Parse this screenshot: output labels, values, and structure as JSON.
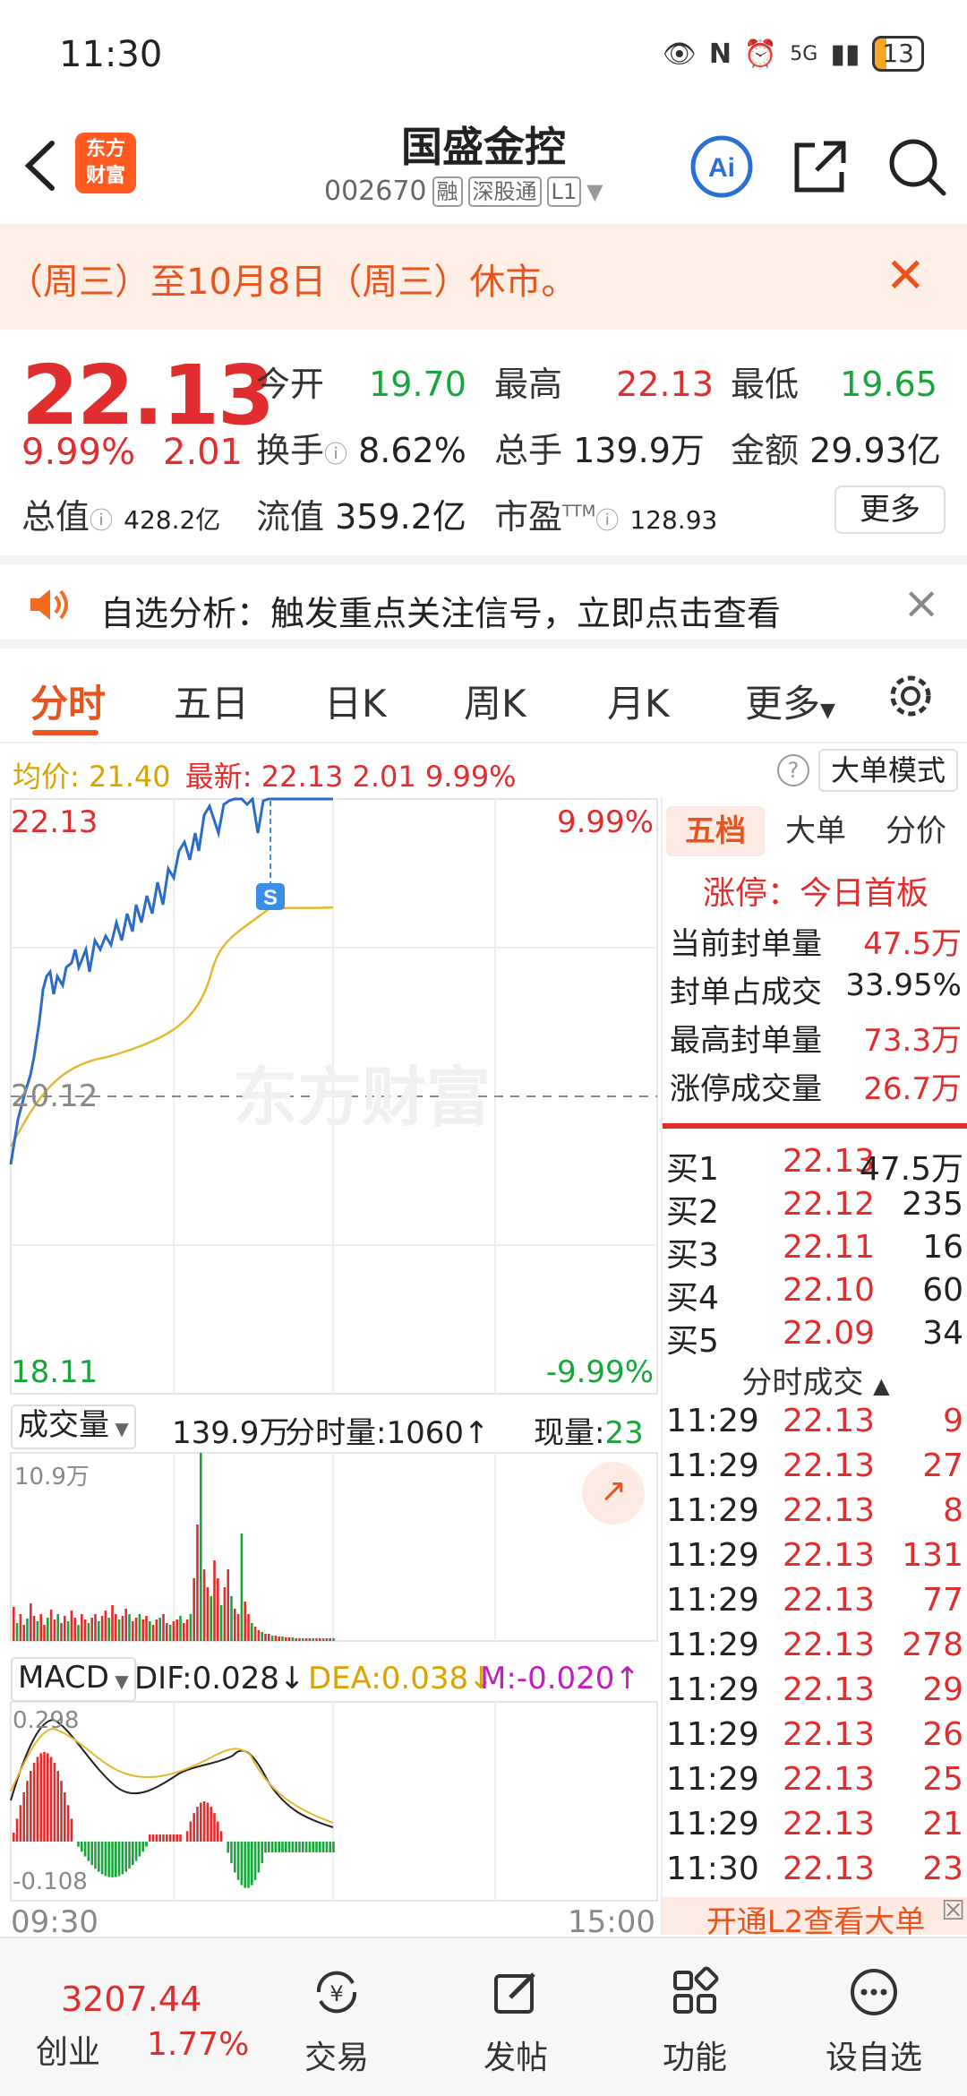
{
  "status": {
    "time": "11:30",
    "battery": "13",
    "signal": "5G"
  },
  "header": {
    "title": "国盛金控",
    "code": "002670",
    "tags": [
      "融",
      "深股通",
      "L1"
    ],
    "logo": "东方财富"
  },
  "notice": {
    "text": "（周三）至10月8日（周三）休市。"
  },
  "quote": {
    "price": "22.13",
    "pct": "9.99%",
    "chg": "2.01",
    "open_label": "今开",
    "open": "19.70",
    "high_label": "最高",
    "high": "22.13",
    "low_label": "最低",
    "low": "19.65",
    "turnover_label": "换手",
    "turnover": "8.62%",
    "volume_label": "总手",
    "volume": "139.9万",
    "amount_label": "金额",
    "amount": "29.93亿",
    "mcap_label": "总值",
    "mcap": "428.2亿",
    "float_label": "流值",
    "float": "359.2亿",
    "pe_label": "市盈",
    "pe_sup": "TTM",
    "pe": "128.93",
    "more": "更多"
  },
  "ad": {
    "text": "自选分析：触发重点关注信号，立即点击查看"
  },
  "tabs": [
    "分时",
    "五日",
    "日K",
    "周K",
    "月K",
    "更多"
  ],
  "avgline": {
    "avg_label": "均价:",
    "avg": "21.40",
    "latest_label": "最新:",
    "latest": "22.13",
    "chg": "2.01",
    "pct": "9.99%",
    "bigmode": "大单模式"
  },
  "chart": {
    "price_top": "22.13",
    "pct_top": "9.99%",
    "price_mid": "20.12",
    "price_bottom": "18.11",
    "pct_bottom": "-9.99%",
    "watermark": "东方财富",
    "signal_mark": "S",
    "vol_label": "成交量",
    "vol_total": "139.9万",
    "vol_min_label": "分时量:",
    "vol_min": "1060",
    "vol_now_label": "现量:",
    "vol_now": "23",
    "vol_max": "10.9万",
    "macd_label": "MACD",
    "dif_label": "DIF:",
    "dif": "0.028",
    "dea_label": "DEA:",
    "dea": "0.038",
    "m_label": "M:",
    "m": "-0.020",
    "macd_top": "0.298",
    "macd_bottom": "-0.108",
    "time_start": "09:30",
    "time_end": "15:00"
  },
  "rpanel": {
    "tabs": [
      "五档",
      "大单",
      "分价"
    ],
    "limit_head": "涨停：今日首板",
    "stats": [
      {
        "label": "当前封单量",
        "value": "47.5万"
      },
      {
        "label": "封单占成交",
        "value": "33.95%"
      },
      {
        "label": "最高封单量",
        "value": "73.3万"
      },
      {
        "label": "涨停成交量",
        "value": "26.7万"
      }
    ],
    "bids": [
      {
        "label": "买1",
        "price": "22.13",
        "qty": "47.5万"
      },
      {
        "label": "买2",
        "price": "22.12",
        "qty": "235"
      },
      {
        "label": "买3",
        "price": "22.11",
        "qty": "16"
      },
      {
        "label": "买4",
        "price": "22.10",
        "qty": "60"
      },
      {
        "label": "买5",
        "price": "22.09",
        "qty": "34"
      }
    ],
    "trades_head": "分时成交",
    "trades": [
      {
        "t": "11:29",
        "p": "22.13",
        "q": "9"
      },
      {
        "t": "11:29",
        "p": "22.13",
        "q": "27"
      },
      {
        "t": "11:29",
        "p": "22.13",
        "q": "8"
      },
      {
        "t": "11:29",
        "p": "22.13",
        "q": "131"
      },
      {
        "t": "11:29",
        "p": "22.13",
        "q": "77"
      },
      {
        "t": "11:29",
        "p": "22.13",
        "q": "278"
      },
      {
        "t": "11:29",
        "p": "22.13",
        "q": "29"
      },
      {
        "t": "11:29",
        "p": "22.13",
        "q": "26"
      },
      {
        "t": "11:29",
        "p": "22.13",
        "q": "25"
      },
      {
        "t": "11:29",
        "p": "22.13",
        "q": "21"
      },
      {
        "t": "11:30",
        "p": "22.13",
        "q": "23"
      }
    ],
    "l2": "开通L2查看大单"
  },
  "bottom": {
    "index_value": "3207.44",
    "index_name": "创业",
    "index_pct": "1.77%",
    "nav": [
      "交易",
      "发帖",
      "功能",
      "设自选"
    ]
  }
}
